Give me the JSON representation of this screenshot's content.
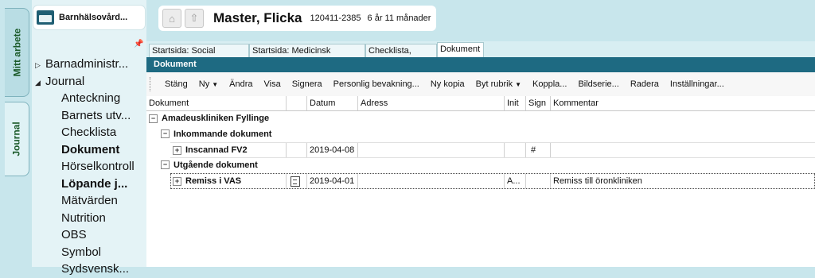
{
  "side_tabs": {
    "mitt_arbete": "Mitt arbete",
    "journal": "Journal"
  },
  "unit": {
    "name": "Barnhälsovård..."
  },
  "tree": [
    {
      "label": "Barnadministr...",
      "level": 0,
      "arrow": "▷",
      "bold": false
    },
    {
      "label": "Journal",
      "level": 0,
      "arrow": "◢",
      "bold": false
    },
    {
      "label": "Anteckning",
      "level": 1,
      "bold": false
    },
    {
      "label": "Barnets utv...",
      "level": 1,
      "bold": false
    },
    {
      "label": "Checklista",
      "level": 1,
      "bold": false
    },
    {
      "label": "Dokument",
      "level": 1,
      "bold": true
    },
    {
      "label": "Hörselkontroll",
      "level": 1,
      "bold": false
    },
    {
      "label": "Löpande j...",
      "level": 1,
      "bold": true
    },
    {
      "label": "Mätvärden",
      "level": 1,
      "bold": false
    },
    {
      "label": "Nutrition",
      "level": 1,
      "bold": false
    },
    {
      "label": "OBS",
      "level": 1,
      "bold": false
    },
    {
      "label": "Symbol",
      "level": 1,
      "bold": false
    },
    {
      "label": "Sydsvensk...",
      "level": 1,
      "bold": false
    }
  ],
  "patient": {
    "name": "Master, Flicka",
    "id": "120411-2385",
    "age": "6 år 11 månader"
  },
  "tabs": [
    "Startsida: Social översikt",
    "Startsida: Medicinsk översikt",
    "Checklista, tabell",
    "Dokument"
  ],
  "active_tab": 3,
  "panel_title": "Dokument",
  "toolbar": [
    {
      "label": "Stäng",
      "dropdown": false
    },
    {
      "label": "Ny",
      "dropdown": true
    },
    {
      "label": "Ändra",
      "dropdown": false
    },
    {
      "label": "Visa",
      "dropdown": false
    },
    {
      "label": "Signera",
      "dropdown": false
    },
    {
      "label": "Personlig bevakning...",
      "dropdown": false
    },
    {
      "label": "Ny kopia",
      "dropdown": false
    },
    {
      "label": "Byt rubrik",
      "dropdown": true
    },
    {
      "label": "Koppla...",
      "dropdown": false
    },
    {
      "label": "Bildserie...",
      "dropdown": false
    },
    {
      "label": "Radera",
      "dropdown": false
    },
    {
      "label": "Inställningar...",
      "dropdown": false
    }
  ],
  "columns": [
    "Dokument",
    "",
    "Datum",
    "Adress",
    "Init",
    "Sign",
    "Kommentar"
  ],
  "groups": {
    "clinic": "Amadeuskliniken Fyllinge",
    "incoming": "Inkommande dokument",
    "outgoing": "Utgående dokument"
  },
  "rows": {
    "incoming_doc": {
      "name": "Inscannad FV2",
      "date": "2019-04-08",
      "address": "",
      "init": "",
      "sign": "#",
      "comment": ""
    },
    "outgoing_doc": {
      "name": "Remiss i VAS",
      "date": "2019-04-01",
      "address": "",
      "init": "A...",
      "sign": "",
      "comment": "Remiss till öronkliniken"
    }
  }
}
